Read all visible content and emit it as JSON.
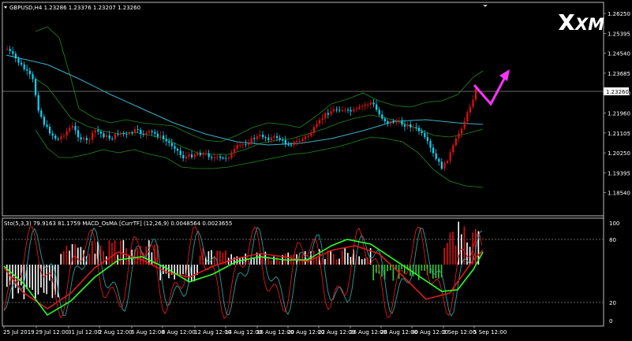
{
  "symbol_header": "GBPUSD,H4  1.23286 1.23376 1.23207 1.23260",
  "indicator_header": "Sto(5,3,3) 79.9163 81.1759  MACD_OsMA [CurrTF] (12,26,9) 0.0048564 0.0023655",
  "logo_text": "XM",
  "current_price_label": "1.23260",
  "price_axis": [
    "1.26250",
    "1.25395",
    "1.24540",
    "1.23685",
    "1.22830",
    "1.21960",
    "1.21105",
    "1.20250",
    "1.19395",
    "1.18540"
  ],
  "indicator_axis": [
    "100",
    "80",
    "20",
    "0"
  ],
  "date_axis": [
    "25 Jul 2019",
    "29 Jul 12:00",
    "31 Jul 12:00",
    "2 Aug 12:00",
    "6 Aug 12:00",
    "8 Aug 12:00",
    "12 Aug 12:00",
    "14 Aug 12:00",
    "16 Aug 12:00",
    "20 Aug 12:00",
    "22 Aug 12:00",
    "26 Aug 12:00",
    "28 Aug 12:00",
    "30 Aug 12:00",
    "3 Sep 12:00",
    "5 Sep 12:00"
  ],
  "colors": {
    "background": "#000000",
    "bull_candle": "#e01010",
    "bear_candle": "#00d8ff",
    "moving_average": "#3ab0c8",
    "bollinger": "#1f8a1f",
    "arrow": "#ff33ff",
    "stoch_main": "#e01818",
    "stoch_signal": "#2aa0a0",
    "macd_line": "#2aff2a",
    "hist_pos": "#e01010",
    "hist_neg": "#ffffff",
    "hist_neg_green": "#33cc33"
  },
  "icons": [
    "xm-logo-icon",
    "dropdown-triangle-icon",
    "forecast-arrow-icon"
  ]
}
